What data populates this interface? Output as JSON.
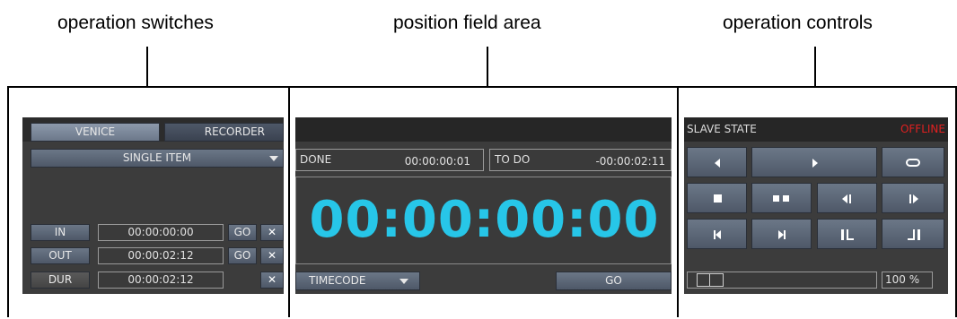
{
  "callouts": {
    "left": "operation switches",
    "middle": "position field area",
    "right": "operation controls"
  },
  "left_panel": {
    "tab_active": "VENICE",
    "tab_inactive": "RECORDER",
    "mode_select": "SINGLE ITEM",
    "rows": [
      {
        "label": "IN",
        "value": "00:00:00:00",
        "go": "GO",
        "clear": "✕"
      },
      {
        "label": "OUT",
        "value": "00:00:02:12",
        "go": "GO",
        "clear": "✕"
      },
      {
        "label": "DUR",
        "value": "00:00:02:12",
        "go": "",
        "clear": "✕"
      }
    ]
  },
  "middle_panel": {
    "done_label": "DONE",
    "done_value": "00:00:00:01",
    "todo_label": "TO DO",
    "todo_value": "-00:00:02:11",
    "timecode": "00:00:00:00",
    "format_select": "TIMECODE",
    "go_label": "GO",
    "timecode_color": "#27c6e8"
  },
  "right_panel": {
    "state_label": "SLAVE STATE",
    "state_value": "OFFLINE",
    "state_color": "#e02020",
    "zoom": "100 %",
    "icons": [
      "rewind-icon",
      "play-icon",
      "loop-icon",
      "stop-icon",
      "pause-icon",
      "step-back-icon",
      "step-forward-icon",
      "go-to-start-icon",
      "go-to-end-icon",
      "mark-in-icon",
      "mark-out-icon"
    ]
  }
}
